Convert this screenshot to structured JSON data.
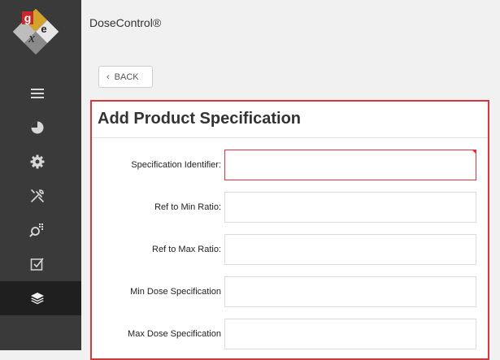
{
  "app": {
    "title": "DoseControl®"
  },
  "nav": {
    "logo_letters": [
      "g",
      "x",
      "e"
    ],
    "items": [
      {
        "id": "menu",
        "icon": "hamburger-menu-icon",
        "active": false
      },
      {
        "id": "dashboard",
        "icon": "pie-chart-icon",
        "active": false
      },
      {
        "id": "settings",
        "icon": "gear-icon",
        "active": false
      },
      {
        "id": "tools",
        "icon": "tools-icon",
        "active": false
      },
      {
        "id": "search",
        "icon": "search-grid-icon",
        "active": false
      },
      {
        "id": "checklist",
        "icon": "checkbox-icon",
        "active": false
      },
      {
        "id": "layers",
        "icon": "layers-icon",
        "active": true
      }
    ]
  },
  "toolbar": {
    "back_label": "BACK"
  },
  "form": {
    "title": "Add Product Specification",
    "fields": [
      {
        "label": "Specification Identifier:",
        "value": "",
        "invalid": true
      },
      {
        "label": "Ref to Min Ratio:",
        "value": "",
        "invalid": false
      },
      {
        "label": "Ref to Max Ratio:",
        "value": "",
        "invalid": false
      },
      {
        "label": "Min Dose Specification",
        "value": "",
        "invalid": false
      },
      {
        "label": "Max Dose Specification",
        "value": "",
        "invalid": false
      }
    ]
  },
  "colors": {
    "sidebar": "#3a3a3a",
    "sidebar_active": "#1f1f1f",
    "accent_error": "#d9363e",
    "logo_red": "#c8282c"
  }
}
